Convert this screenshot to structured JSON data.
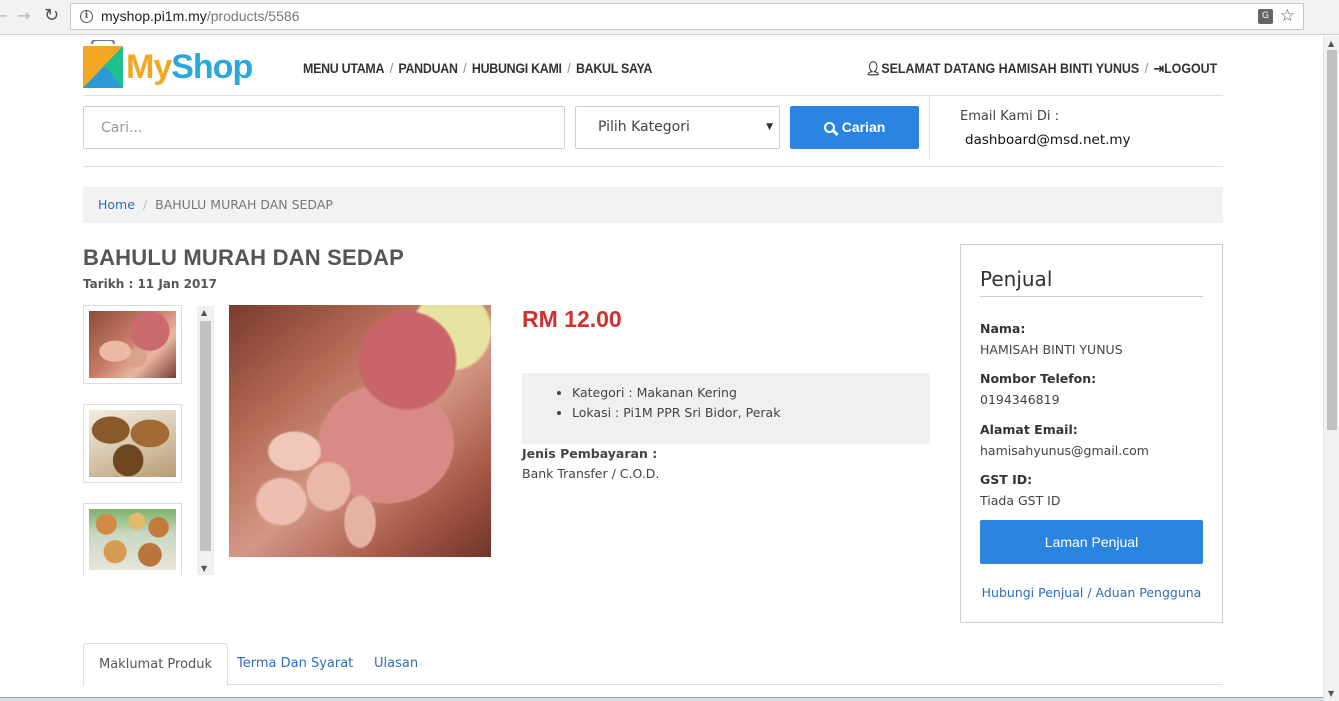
{
  "browser": {
    "url_host": "myshop.pi1m.my",
    "url_path": "/products/5586"
  },
  "header": {
    "logo_my": "My",
    "logo_shop": "Shop",
    "nav": [
      "MENU UTAMA",
      "PANDUAN",
      "HUBUNGI KAMI",
      "BAKUL SAYA"
    ],
    "welcome": "SELAMAT DATANG HAMISAH BINTI YUNUS",
    "logout": "LOGOUT"
  },
  "search": {
    "placeholder": "Cari...",
    "category_selected": "Pilih Kategori",
    "button_label": "Carian",
    "email_label": "Email Kami Di :",
    "email_value": "dashboard@msd.net.my"
  },
  "breadcrumb": {
    "home": "Home",
    "current": "BAHULU MURAH DAN SEDAP"
  },
  "product": {
    "title": "BAHULU MURAH DAN SEDAP",
    "date": "Tarikh : 11 Jan 2017",
    "price": "RM 12.00",
    "category": "Kategori : Makanan Kering",
    "location": "Lokasi : Pi1M PPR Sri Bidor, Perak",
    "payment_label": "Jenis Pembayaran :",
    "payment_value": "Bank Transfer / C.O.D."
  },
  "seller": {
    "title": "Penjual",
    "name_label": "Nama:",
    "name_value": "HAMISAH BINTI YUNUS",
    "phone_label": "Nombor Telefon:",
    "phone_value": "0194346819",
    "email_label": "Alamat Email:",
    "email_value": "hamisahyunus@gmail.com",
    "gst_label": "GST ID:",
    "gst_value": "Tiada GST ID",
    "button_label": "Laman Penjual",
    "contact_link": "Hubungi Penjual / Aduan Pengguna"
  },
  "tabs": [
    "Maklumat Produk",
    "Terma Dan Syarat",
    "Ulasan"
  ],
  "colors": {
    "primary": "#2a84e0",
    "price": "#d0312d",
    "link": "#2a6ebb",
    "logo_orange": "#f5a623",
    "logo_blue": "#29a8e0"
  }
}
